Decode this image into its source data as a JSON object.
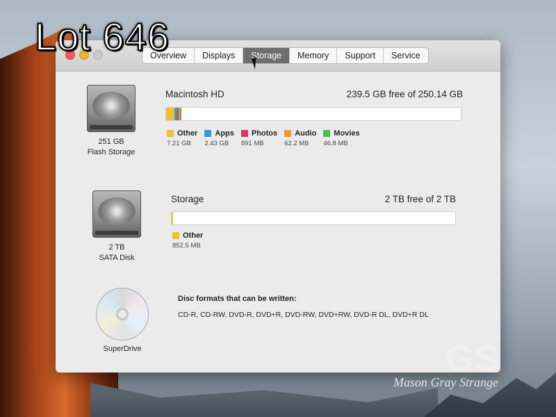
{
  "overlay": {
    "lot_label": "Lot 646",
    "watermark_letters": "GS",
    "watermark": "Mason Gray Strange"
  },
  "window": {
    "tabs": [
      {
        "label": "Overview",
        "active": false
      },
      {
        "label": "Displays",
        "active": false
      },
      {
        "label": "Storage",
        "active": true
      },
      {
        "label": "Memory",
        "active": false
      },
      {
        "label": "Support",
        "active": false
      },
      {
        "label": "Service",
        "active": false
      }
    ]
  },
  "drives": [
    {
      "icon": "hard-drive-icon",
      "size_line": "251 GB",
      "type_line": "Flash Storage",
      "name": "Macintosh HD",
      "free": "239.5 GB free of 250.14 GB",
      "usage": [
        {
          "name": "Other",
          "size": "7.21 GB",
          "color": "#f0c02e",
          "fraction": 0.0288
        },
        {
          "name": "Apps",
          "size": "2.43 GB",
          "color": "#2f9fd8",
          "fraction": 0.0097
        },
        {
          "name": "Photos",
          "size": "891 MB",
          "color": "#e3345b",
          "fraction": 0.0036
        },
        {
          "name": "Audio",
          "size": "62.2 MB",
          "color": "#f39a2b",
          "fraction": 0.0003
        },
        {
          "name": "Movies",
          "size": "46.8 MB",
          "color": "#4cbc4a",
          "fraction": 0.0002
        }
      ]
    },
    {
      "icon": "hard-drive-icon",
      "size_line": "2 TB",
      "type_line": "SATA Disk",
      "name": "Storage",
      "free": "2 TB free of 2 TB",
      "usage": [
        {
          "name": "Other",
          "size": "852.5 MB",
          "color": "#f0c02e",
          "fraction": 0.0004
        }
      ]
    }
  ],
  "superdrive": {
    "icon": "optical-disc-icon",
    "label": "SuperDrive",
    "formats_title": "Disc formats that can be written:",
    "formats": "CD-R, CD-RW, DVD-R, DVD+R, DVD-RW, DVD+RW, DVD-R DL, DVD+R DL"
  }
}
